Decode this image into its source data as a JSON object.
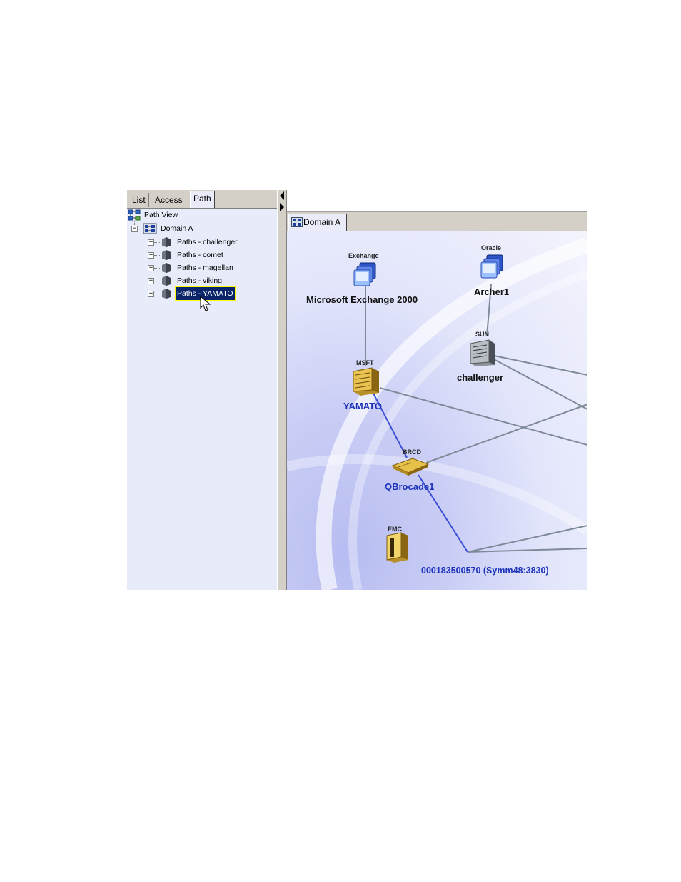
{
  "left_tabs": [
    "List",
    "Access",
    "Path"
  ],
  "active_left_tab": "Path",
  "tree": {
    "root": "Path View",
    "domain": "Domain A",
    "items": [
      "Paths - challenger",
      "Paths - comet",
      "Paths - magellan",
      "Paths - viking",
      "Paths - YAMATO"
    ],
    "selected": "Paths - YAMATO"
  },
  "right_tab": "Domain A",
  "topology": {
    "nodes": [
      {
        "id": "exchange",
        "type_label": "Exchange",
        "name": "Microsoft Exchange 2000",
        "icon": "application-icon"
      },
      {
        "id": "archer1",
        "type_label": "Oracle",
        "name": "Archer1",
        "icon": "application-icon"
      },
      {
        "id": "challenger",
        "type_label": "SUN",
        "name": "challenger",
        "icon": "server-icon"
      },
      {
        "id": "yamato",
        "type_label": "MSFT",
        "name": "YAMATO",
        "icon": "host-icon"
      },
      {
        "id": "qbrocade1",
        "type_label": "BRCD",
        "name": "QBrocade1",
        "icon": "switch-icon"
      },
      {
        "id": "symm",
        "type_label": "EMC",
        "name": "000183500570 (Symm48:3830)",
        "icon": "storage-icon"
      }
    ]
  },
  "colors": {
    "path_highlight": "#3b4fd6",
    "link": "#7f8a99",
    "selection": "#0a246a",
    "blue_label": "#1c33b9"
  }
}
